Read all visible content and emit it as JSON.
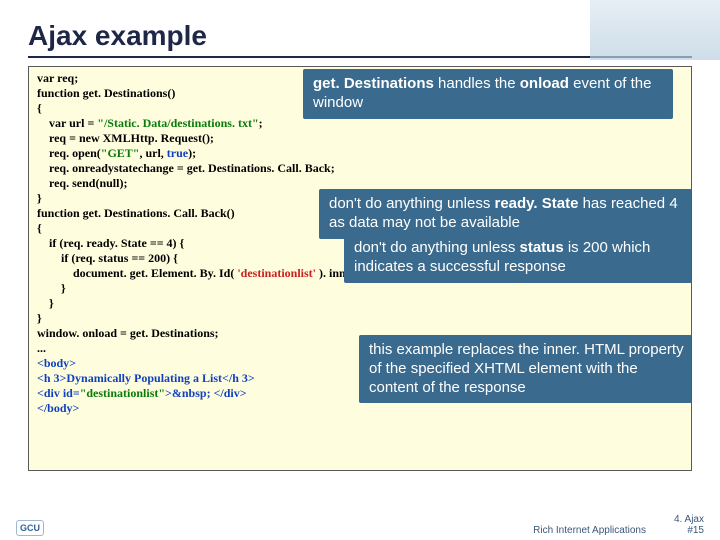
{
  "title": "Ajax example",
  "code": {
    "l1": "var req;",
    "l2": "function get. Destinations()",
    "l3": "{",
    "l4_pre": "    var url = ",
    "l4_str": "\"/Static. Data/destinations. txt\"",
    "l4_post": ";",
    "l5": "    req = new XMLHttp. Request();",
    "l6_pre": "    req. open(",
    "l6_s1": "\"GET\"",
    "l6_mid": ", url, ",
    "l6_kw": "true",
    "l6_post": ");",
    "l7": "    req. onreadystatechange = get. Destinations. Call. Back;",
    "l8": "    req. send(null);",
    "l9": "}",
    "l10": "function get. Destinations. Call. Back()",
    "l11": "{",
    "l12": "    if (req. ready. State == 4) {",
    "l13": "        if (req. status == 200) {",
    "l14_pre": "            document. get. Element. By. Id( ",
    "l14_str": "'destinationlist'",
    "l14_post": " ). inner. HTML =  req. response. Text;",
    "l15": "        }",
    "l16": "    }",
    "l17": "}",
    "l18": "window. onload = get. Destinations;",
    "l19": "...",
    "l20": "<body>",
    "l21": "<h 3>Dynamically Populating a List</h 3>",
    "l22_pre": "<div id=",
    "l22_str": "\"destinationlist\"",
    "l22_post": ">&nbsp; </div>",
    "l23": "</body>"
  },
  "callouts": {
    "c1_a": "get. Destinations",
    "c1_b": " handles the ",
    "c1_c": "onload",
    "c1_d": " event of the window",
    "c2_a": "don't do anything unless ",
    "c2_b": "ready. State",
    "c2_c": " has reached 4 as data may not be available",
    "c3_a": "don't do anything unless ",
    "c3_b": "status",
    "c3_c": " is 200 which indicates a successful response",
    "c4": "this example replaces the inner. HTML property of the specified XHTML element with the content of the response"
  },
  "footer": {
    "logo": "GCU",
    "center": "Rich Internet Applications",
    "right1": "4. Ajax",
    "right2": "#15"
  }
}
